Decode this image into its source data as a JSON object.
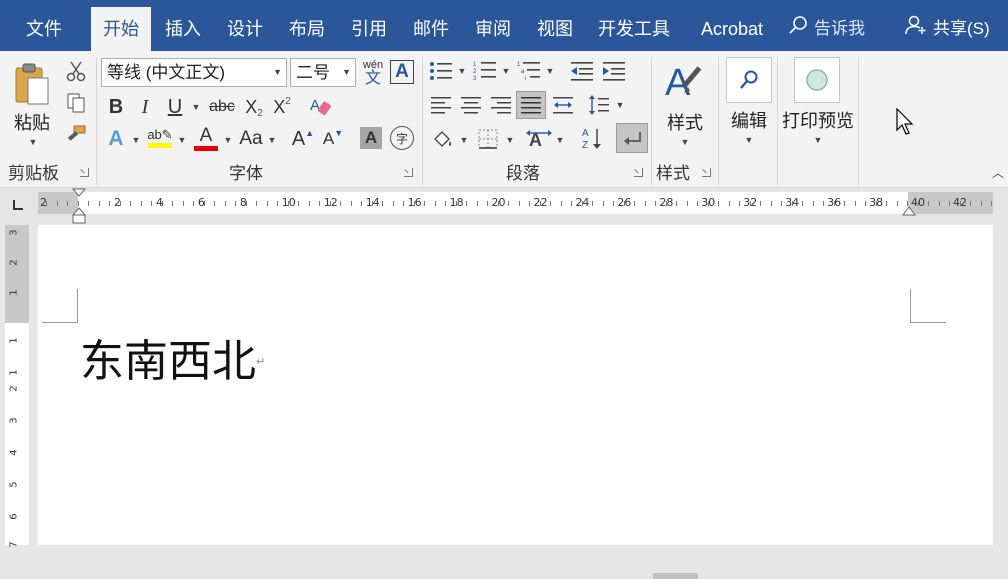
{
  "tabs": [
    {
      "label": "文件",
      "active": false
    },
    {
      "label": "开始",
      "active": true
    },
    {
      "label": "插入",
      "active": false
    },
    {
      "label": "设计",
      "active": false
    },
    {
      "label": "布局",
      "active": false
    },
    {
      "label": "引用",
      "active": false
    },
    {
      "label": "邮件",
      "active": false
    },
    {
      "label": "审阅",
      "active": false
    },
    {
      "label": "视图",
      "active": false
    },
    {
      "label": "开发工具",
      "active": false
    },
    {
      "label": "Acrobat",
      "active": false
    }
  ],
  "tell_me": "告诉我",
  "share": "共享(S)",
  "clipboard": {
    "paste_label": "粘贴",
    "group_label": "剪贴板"
  },
  "font": {
    "font_name": "等线 (中文正文)",
    "font_size": "二号",
    "phonetic_label": "wén",
    "phonetic_char": "文",
    "char_border_label": "A",
    "group_label": "字体",
    "highlight_color": "#ffff00",
    "font_color": "#e00000",
    "bold": "B",
    "italic": "I",
    "underline": "U",
    "strike": "abc",
    "subscript": "X",
    "superscript": "X",
    "change_case": "Aa",
    "grow": "A",
    "shrink": "A",
    "shading": "A",
    "enclose": "字"
  },
  "paragraph": {
    "group_label": "段落"
  },
  "styles": {
    "label": "样式",
    "group_label": "样式"
  },
  "editing": {
    "label": "编辑"
  },
  "print_preview": {
    "label": "打印预览"
  },
  "ruler": {
    "numbers": [
      "2",
      "2",
      "4",
      "6",
      "8",
      "10",
      "12",
      "14",
      "16",
      "18",
      "20",
      "22",
      "24",
      "26",
      "28",
      "30",
      "32",
      "34",
      "36",
      "38",
      "40",
      "42"
    ],
    "vertical_numbers": [
      "3",
      "2",
      "1",
      "1",
      "1",
      "2",
      "3",
      "4",
      "5",
      "6",
      "7"
    ]
  },
  "document": {
    "text": "东南西北",
    "para_mark": "↵"
  },
  "colors": {
    "accent": "#2b579a",
    "ribbon": "#f3f3f3"
  }
}
